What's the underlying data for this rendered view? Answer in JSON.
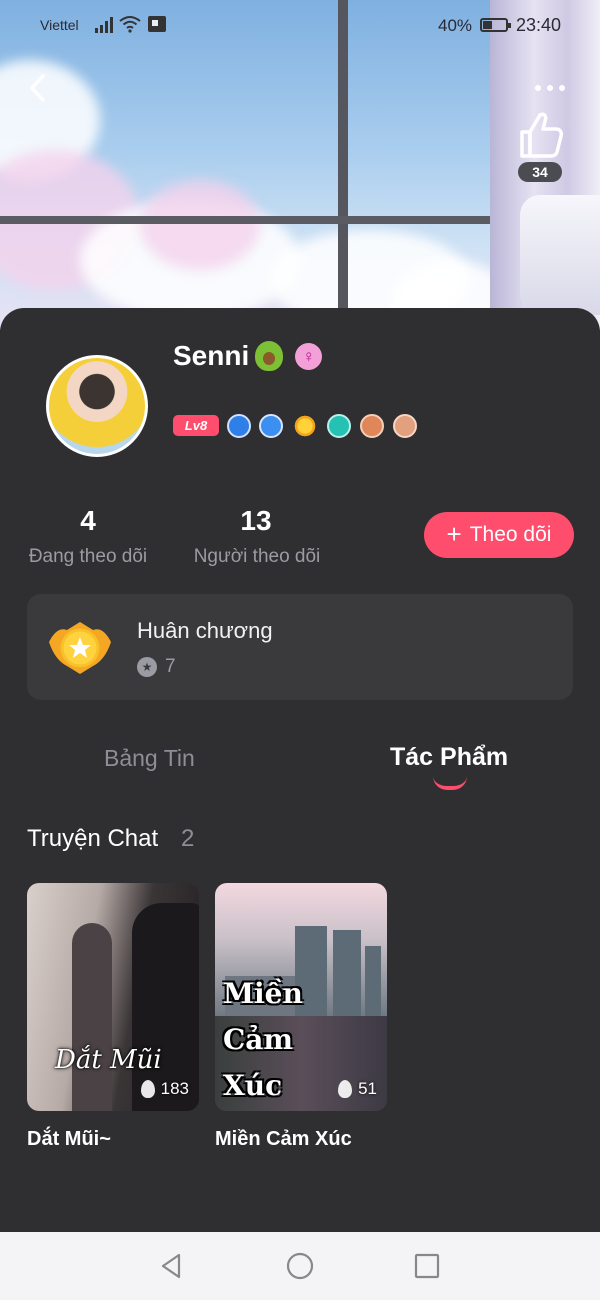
{
  "status_bar": {
    "carrier": "Viettel",
    "battery_percent": "40%",
    "battery_level": 0.4,
    "time": "23:40"
  },
  "header": {
    "like_count": "34"
  },
  "profile": {
    "username": "Senni",
    "level_badge": "Lv8",
    "stats": [
      {
        "value": "4",
        "label": "Đang theo dõi"
      },
      {
        "value": "13",
        "label": "Người theo dõi"
      }
    ],
    "follow_button": "Theo dõi"
  },
  "medals": {
    "title": "Huân chương",
    "count": "7"
  },
  "tabs": [
    {
      "label": "Bảng Tin",
      "active": false
    },
    {
      "label": "Tác Phẩm",
      "active": true
    }
  ],
  "section": {
    "title": "Truyện Chat",
    "count": "2"
  },
  "stories": [
    {
      "cover_title": "Dắt Mũi",
      "views": "183",
      "name": "Dắt Mũi~"
    },
    {
      "cover_title_lines": [
        "Miền",
        "Cảm",
        "Xúc"
      ],
      "views": "51",
      "name": "Miền Cảm Xúc"
    }
  ],
  "colors": {
    "accent": "#ff4d6d",
    "background": "#2f2f31",
    "card": "#3a3a3d"
  }
}
